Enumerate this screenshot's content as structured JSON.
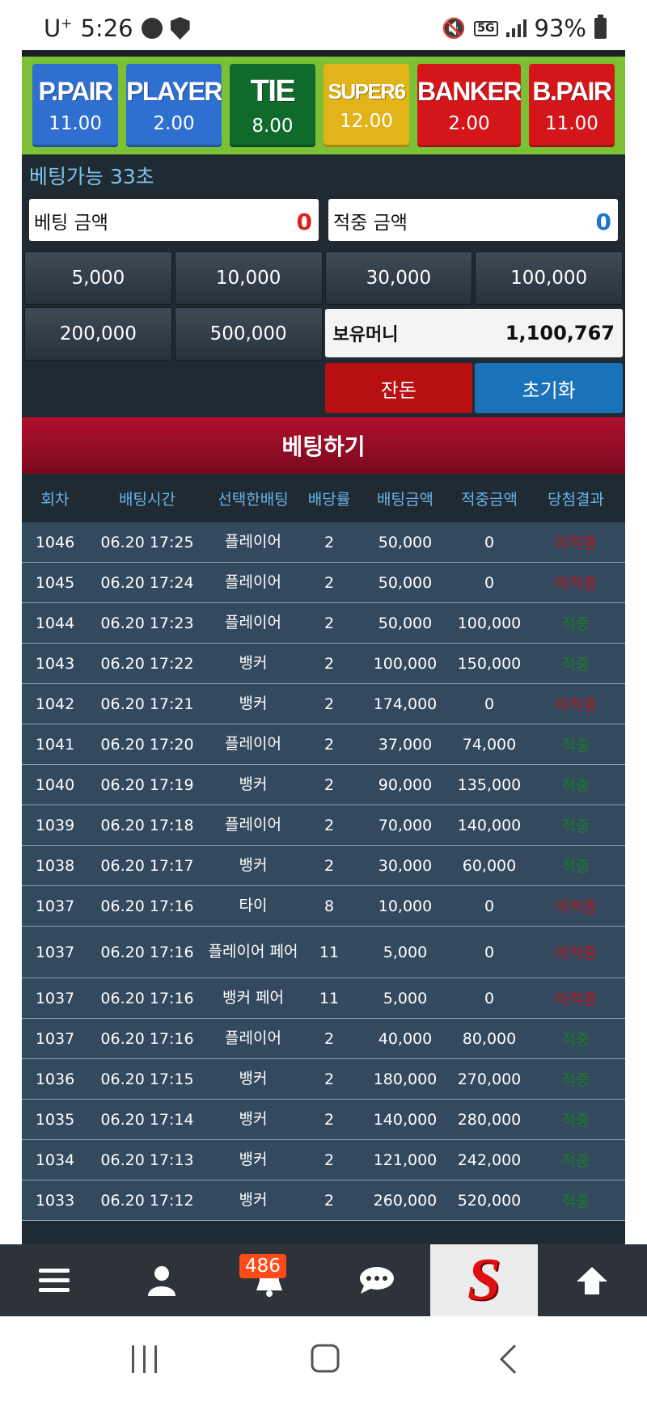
{
  "status_bar": {
    "carrier": "U",
    "carrier_sup": "+",
    "time": "5:26",
    "network": "5G",
    "battery": "93%"
  },
  "bet_options": [
    {
      "name": "P.PAIR",
      "odds": "11.00",
      "color": "#2f6fd0"
    },
    {
      "name": "PLAYER",
      "odds": "2.00",
      "color": "#2f6fd0"
    },
    {
      "name": "TIE",
      "odds": "8.00",
      "color": "#0f6a2c"
    },
    {
      "name": "SUPER6",
      "odds": "12.00",
      "color": "#e3b31a"
    },
    {
      "name": "BANKER",
      "odds": "2.00",
      "color": "#d4161b"
    },
    {
      "name": "B.PAIR",
      "odds": "11.00",
      "color": "#d4161b"
    }
  ],
  "timer_text": "베팅가능 33초",
  "bet_amount": {
    "label": "베팅 금액",
    "value": "0"
  },
  "win_amount": {
    "label": "적중 금액",
    "value": "0"
  },
  "chips": [
    "5,000",
    "10,000",
    "30,000",
    "100,000",
    "200,000",
    "500,000"
  ],
  "balance": {
    "label": "보유머니",
    "value": "1,100,767"
  },
  "actions": {
    "change": "잔돈",
    "reset": "초기화"
  },
  "place_bet": "베팅하기",
  "table": {
    "headers": [
      "회차",
      "배팅시간",
      "선택한배팅",
      "배당률",
      "배팅금액",
      "적중금액",
      "당첨결과"
    ],
    "rows": [
      [
        "1046",
        "06.20 17:25",
        "플레이어",
        "2",
        "50,000",
        "0",
        "미적중"
      ],
      [
        "1045",
        "06.20 17:24",
        "플레이어",
        "2",
        "50,000",
        "0",
        "미적중"
      ],
      [
        "1044",
        "06.20 17:23",
        "플레이어",
        "2",
        "50,000",
        "100,000",
        "적중"
      ],
      [
        "1043",
        "06.20 17:22",
        "뱅커",
        "2",
        "100,000",
        "150,000",
        "적중"
      ],
      [
        "1042",
        "06.20 17:21",
        "뱅커",
        "2",
        "174,000",
        "0",
        "미적중"
      ],
      [
        "1041",
        "06.20 17:20",
        "플레이어",
        "2",
        "37,000",
        "74,000",
        "적중"
      ],
      [
        "1040",
        "06.20 17:19",
        "뱅커",
        "2",
        "90,000",
        "135,000",
        "적중"
      ],
      [
        "1039",
        "06.20 17:18",
        "플레이어",
        "2",
        "70,000",
        "140,000",
        "적중"
      ],
      [
        "1038",
        "06.20 17:17",
        "뱅커",
        "2",
        "30,000",
        "60,000",
        "적중"
      ],
      [
        "1037",
        "06.20 17:16",
        "타이",
        "8",
        "10,000",
        "0",
        "미적중"
      ],
      [
        "1037",
        "06.20 17:16",
        "플레이어 페어",
        "11",
        "5,000",
        "0",
        "미적중"
      ],
      [
        "1037",
        "06.20 17:16",
        "뱅커 페어",
        "11",
        "5,000",
        "0",
        "미적중"
      ],
      [
        "1037",
        "06.20 17:16",
        "플레이어",
        "2",
        "40,000",
        "80,000",
        "적중"
      ],
      [
        "1036",
        "06.20 17:15",
        "뱅커",
        "2",
        "180,000",
        "270,000",
        "적중"
      ],
      [
        "1035",
        "06.20 17:14",
        "뱅커",
        "2",
        "140,000",
        "280,000",
        "적중"
      ],
      [
        "1034",
        "06.20 17:13",
        "뱅커",
        "2",
        "121,000",
        "242,000",
        "적중"
      ],
      [
        "1033",
        "06.20 17:12",
        "뱅커",
        "2",
        "260,000",
        "520,000",
        "적중"
      ]
    ]
  },
  "bottom_nav": {
    "items": [
      "menu-icon",
      "user-icon",
      "bell-icon",
      "chat-icon",
      "site-logo",
      "arrow-up-icon"
    ],
    "notification_count": "486",
    "logo_letter": "S"
  }
}
